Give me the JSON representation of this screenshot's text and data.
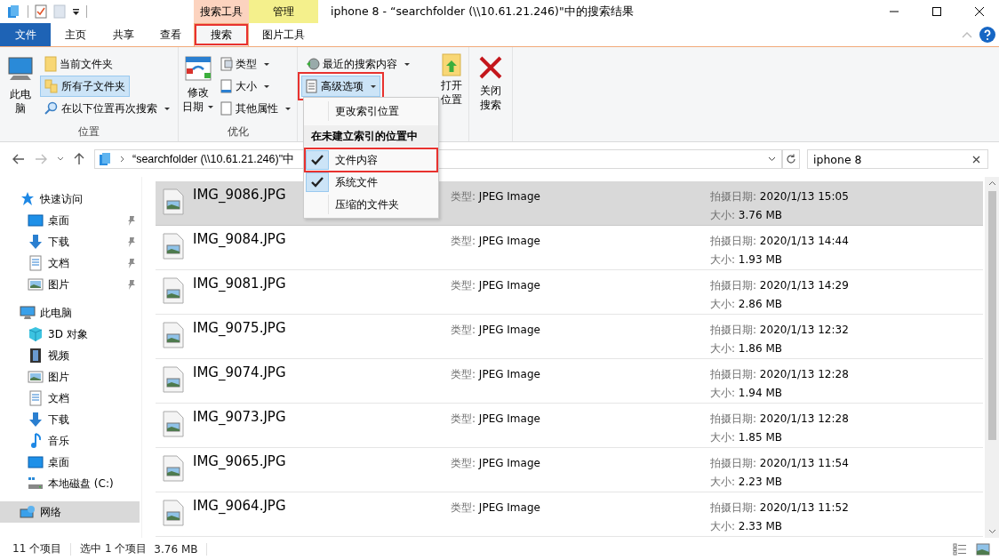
{
  "window": {
    "title": "iphone 8 - “searchfolder (\\\\10.61.21.246)\"中的搜索结果"
  },
  "contextual_tabs": [
    {
      "label": "搜索工具",
      "color": "#fcd3bf"
    },
    {
      "label": "管理",
      "color": "#f4f08c"
    }
  ],
  "tabs": [
    {
      "label": "文件",
      "kind": "file",
      "selected": false,
      "highlighted": false
    },
    {
      "label": "主页",
      "kind": "normal",
      "selected": false,
      "highlighted": false
    },
    {
      "label": "共享",
      "kind": "normal",
      "selected": false,
      "highlighted": false
    },
    {
      "label": "查看",
      "kind": "normal",
      "selected": false,
      "highlighted": false
    },
    {
      "label": "搜索",
      "kind": "normal",
      "selected": true,
      "highlighted": true
    },
    {
      "label": "图片工具",
      "kind": "normal",
      "selected": false,
      "highlighted": false
    }
  ],
  "ribbon": {
    "groups": [
      {
        "label": "位置",
        "big": {
          "lines": [
            "此电",
            "脑"
          ]
        },
        "items": [
          {
            "label": "当前文件夹",
            "selected": false,
            "dropdown": false,
            "highlighted": false
          },
          {
            "label": "所有子文件夹",
            "selected": true,
            "dropdown": false,
            "highlighted": false
          },
          {
            "label": "在以下位置再次搜索",
            "selected": false,
            "dropdown": true,
            "highlighted": false
          }
        ]
      },
      {
        "label": "优化",
        "big": {
          "lines": [
            "修改",
            "日期"
          ],
          "dropdown": true
        },
        "items": [
          {
            "label": "类型",
            "selected": false,
            "dropdown": true,
            "highlighted": false
          },
          {
            "label": "大小",
            "selected": false,
            "dropdown": true,
            "highlighted": false
          },
          {
            "label": "其他属性",
            "selected": false,
            "dropdown": true,
            "highlighted": false
          }
        ]
      },
      {
        "big": {
          "lines": [
            "打开",
            "位置"
          ]
        },
        "items": [
          {
            "label": "最近的搜索内容",
            "selected": false,
            "dropdown": true,
            "highlighted": false
          },
          {
            "label": "高级选项",
            "selected": true,
            "dropdown": true,
            "highlighted": true
          }
        ]
      },
      {
        "big": {
          "lines": [
            "关闭",
            "搜索"
          ]
        }
      }
    ]
  },
  "dropdown_menu": {
    "items": [
      {
        "kind": "command",
        "label": "更改索引位置"
      },
      {
        "kind": "header",
        "label": "在未建立索引的位置中"
      },
      {
        "kind": "check",
        "label": "文件内容",
        "checked": true,
        "highlighted": true
      },
      {
        "kind": "check",
        "label": "系统文件",
        "checked": true,
        "highlighted": false
      },
      {
        "kind": "check",
        "label": "压缩的文件夹",
        "checked": false,
        "highlighted": false
      }
    ]
  },
  "address_bar": {
    "path": "“searchfolder (\\\\10.61.21.246)\"中"
  },
  "search": {
    "value": "iphone 8"
  },
  "sidebar": {
    "items": [
      {
        "label": "快速访问",
        "kind": "quick-access",
        "selected": false,
        "pinned": false,
        "children": [
          {
            "label": "桌面",
            "kind": "desktop",
            "selected": false,
            "pinned": true
          },
          {
            "label": "下载",
            "kind": "downloads",
            "selected": false,
            "pinned": true
          },
          {
            "label": "文档",
            "kind": "documents",
            "selected": false,
            "pinned": true
          },
          {
            "label": "图片",
            "kind": "pictures",
            "selected": false,
            "pinned": true
          }
        ]
      },
      {
        "label": "此电脑",
        "kind": "pc",
        "selected": false,
        "pinned": false,
        "children": [
          {
            "label": "3D 对象",
            "kind": "objects3d",
            "selected": false,
            "pinned": false
          },
          {
            "label": "视频",
            "kind": "videos",
            "selected": false,
            "pinned": false
          },
          {
            "label": "图片",
            "kind": "pictures",
            "selected": false,
            "pinned": false
          },
          {
            "label": "文档",
            "kind": "documents",
            "selected": false,
            "pinned": false
          },
          {
            "label": "下载",
            "kind": "downloads",
            "selected": false,
            "pinned": false
          },
          {
            "label": "音乐",
            "kind": "music",
            "selected": false,
            "pinned": false
          },
          {
            "label": "桌面",
            "kind": "desktop",
            "selected": false,
            "pinned": false
          },
          {
            "label": "本地磁盘 (C:)",
            "kind": "drive",
            "selected": false,
            "pinned": false
          }
        ]
      },
      {
        "label": "网络",
        "kind": "network",
        "selected": true,
        "pinned": false
      }
    ]
  },
  "files": [
    {
      "name": "IMG_9086.JPG",
      "type_label": "类型:",
      "type": "JPEG Image",
      "date_label": "拍摄日期:",
      "date": "2020/1/13 15:05",
      "size_label": "大小:",
      "size": "3.76 MB",
      "selected": true
    },
    {
      "name": "IMG_9084.JPG",
      "type_label": "类型:",
      "type": "JPEG Image",
      "date_label": "拍摄日期:",
      "date": "2020/1/13 14:44",
      "size_label": "大小:",
      "size": "1.93 MB",
      "selected": false
    },
    {
      "name": "IMG_9081.JPG",
      "type_label": "类型:",
      "type": "JPEG Image",
      "date_label": "拍摄日期:",
      "date": "2020/1/13 14:29",
      "size_label": "大小:",
      "size": "2.86 MB",
      "selected": false
    },
    {
      "name": "IMG_9075.JPG",
      "type_label": "类型:",
      "type": "JPEG Image",
      "date_label": "拍摄日期:",
      "date": "2020/1/13 12:32",
      "size_label": "大小:",
      "size": "1.86 MB",
      "selected": false
    },
    {
      "name": "IMG_9074.JPG",
      "type_label": "类型:",
      "type": "JPEG Image",
      "date_label": "拍摄日期:",
      "date": "2020/1/13 12:28",
      "size_label": "大小:",
      "size": "1.94 MB",
      "selected": false
    },
    {
      "name": "IMG_9073.JPG",
      "type_label": "类型:",
      "type": "JPEG Image",
      "date_label": "拍摄日期:",
      "date": "2020/1/13 12:28",
      "size_label": "大小:",
      "size": "1.85 MB",
      "selected": false
    },
    {
      "name": "IMG_9065.JPG",
      "type_label": "类型:",
      "type": "JPEG Image",
      "date_label": "拍摄日期:",
      "date": "2020/1/13 11:54",
      "size_label": "大小:",
      "size": "2.23 MB",
      "selected": false
    },
    {
      "name": "IMG_9064.JPG",
      "type_label": "类型:",
      "type": "JPEG Image",
      "date_label": "拍摄日期:",
      "date": "2020/1/13 11:52",
      "size_label": "大小:",
      "size": "2.33 MB",
      "selected": false
    }
  ],
  "status_bar": {
    "count": "11 个项目",
    "selection": "选中 1 个项目",
    "selection_size": "3.76 MB"
  }
}
